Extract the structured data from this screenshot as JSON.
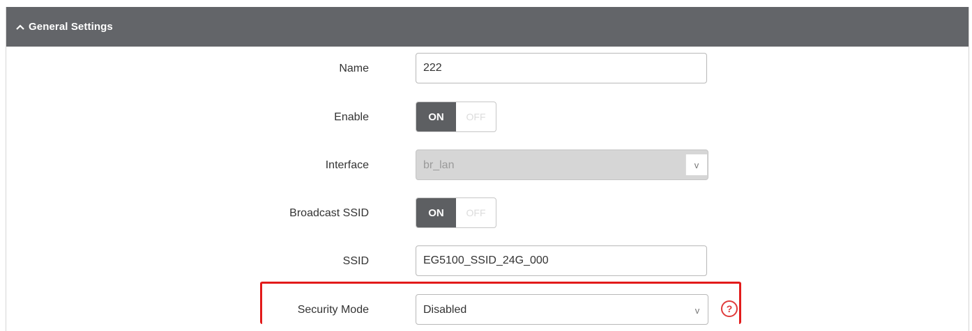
{
  "header": {
    "title": "General Settings",
    "icon": "chevron-up-icon"
  },
  "fields": {
    "name": {
      "label": "Name",
      "value": "222"
    },
    "enable": {
      "label": "Enable",
      "on_label": "ON",
      "off_label": "OFF",
      "state": "on"
    },
    "interface": {
      "label": "Interface",
      "value": "br_lan",
      "disabled": true,
      "arrow": "v"
    },
    "broadcast_ssid": {
      "label": "Broadcast SSID",
      "on_label": "ON",
      "off_label": "OFF",
      "state": "on"
    },
    "ssid": {
      "label": "SSID",
      "value": "EG5100_SSID_24G_000"
    },
    "security_mode": {
      "label": "Security Mode",
      "value": "Disabled",
      "arrow": "v",
      "help": "?"
    }
  },
  "colors": {
    "header_bg": "#636569",
    "toggle_on_bg": "#5d5f62",
    "highlight": "#e21b1b",
    "help_icon": "#e03a3a"
  }
}
